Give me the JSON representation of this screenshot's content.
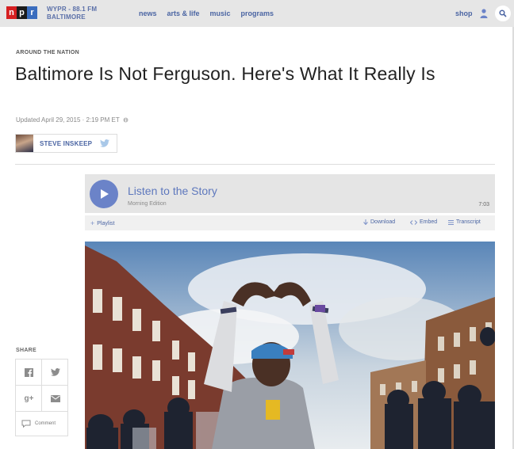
{
  "header": {
    "logo": [
      "n",
      "p",
      "r"
    ],
    "station_line1": "WYPR - 88.1 FM",
    "station_line2": "BALTIMORE",
    "nav": [
      "news",
      "arts & life",
      "music",
      "programs"
    ],
    "shop": "shop"
  },
  "article": {
    "section": "AROUND THE NATION",
    "headline": "Baltimore Is Not Ferguson. Here's What It Really Is",
    "updated": "Updated April 29, 2015 · 2:19 PM ET",
    "author": "STEVE INSKEEP"
  },
  "player": {
    "title": "Listen to the Story",
    "program": "Morning Edition",
    "duration": "7:03",
    "playlist": "Playlist",
    "download": "Download",
    "embed": "Embed",
    "transcript": "Transcript"
  },
  "share": {
    "label": "SHARE",
    "gplus": "g+",
    "comment": "Comment"
  },
  "colors": {
    "accent": "#4b65a3",
    "play": "#6b83c8",
    "npr_red": "#d62021",
    "npr_black": "#1b1b1b",
    "npr_blue": "#3a6dbe"
  }
}
